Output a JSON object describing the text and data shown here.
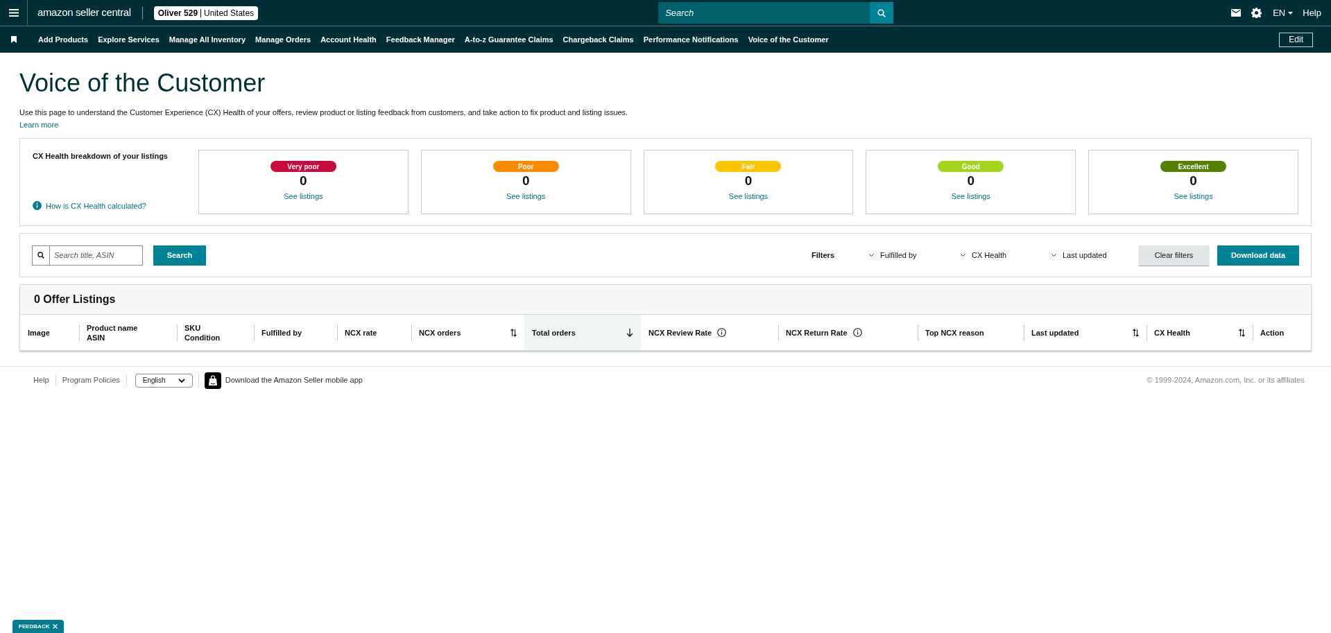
{
  "header": {
    "logo": "amazon seller central",
    "account": {
      "name": "Oliver 529",
      "market": "United States"
    },
    "search": {
      "placeholder": "Search"
    },
    "language": "EN",
    "help": "Help"
  },
  "nav": {
    "items": [
      "Add Products",
      "Explore Services",
      "Manage All Inventory",
      "Manage Orders",
      "Account Health",
      "Feedback Manager",
      "A-to-z Guarantee Claims",
      "Chargeback Claims",
      "Performance Notifications",
      "Voice of the Customer"
    ],
    "edit": "Edit"
  },
  "page": {
    "title": "Voice of the Customer",
    "description": "Use this page to understand the Customer Experience (CX) Health of your offers, review product or listing feedback from customers, and take action to fix product and listing issues.",
    "learn_more": "Learn more"
  },
  "breakdown": {
    "title": "CX Health breakdown of your listings",
    "help_link": "How is CX Health calculated?",
    "cards": [
      {
        "label": "Very poor",
        "color": "#c7093b",
        "count": "0",
        "link": "See listings"
      },
      {
        "label": "Poor",
        "color": "#ff8c00",
        "count": "0",
        "link": "See listings"
      },
      {
        "label": "Fair",
        "color": "#ffc400",
        "count": "0",
        "link": "See listings"
      },
      {
        "label": "Good",
        "color": "#a4d41c",
        "count": "0",
        "link": "See listings"
      },
      {
        "label": "Excellent",
        "color": "#538000",
        "count": "0",
        "link": "See listings"
      }
    ]
  },
  "filters": {
    "search": {
      "placeholder": "Search title, ASIN"
    },
    "search_button": "Search",
    "label": "Filters",
    "dropdowns": [
      "Fulfilled by",
      "CX Health",
      "Last updated"
    ],
    "clear": "Clear filters",
    "download": "Download data"
  },
  "table": {
    "title": "0 Offer Listings",
    "columns": [
      {
        "label": "Image",
        "kind": "plain",
        "selected": false
      },
      {
        "label": "Product name",
        "sublabel": "ASIN",
        "kind": "plain",
        "selected": false
      },
      {
        "label": "SKU",
        "sublabel": "Condition",
        "kind": "plain",
        "selected": false
      },
      {
        "label": "Fulfilled by",
        "kind": "plain",
        "selected": false
      },
      {
        "label": "NCX rate",
        "kind": "plain",
        "selected": false
      },
      {
        "label": "NCX orders",
        "kind": "sortable",
        "selected": false
      },
      {
        "label": "Total orders",
        "kind": "sortable",
        "selected": true
      },
      {
        "label": "NCX Review Rate",
        "kind": "info",
        "selected": false
      },
      {
        "label": "NCX Return Rate",
        "kind": "info",
        "selected": false
      },
      {
        "label": "Top NCX reason",
        "kind": "plain",
        "selected": false
      },
      {
        "label": "Last updated",
        "kind": "sortable",
        "selected": false
      },
      {
        "label": "CX Health",
        "kind": "sortable",
        "selected": false
      },
      {
        "label": "Action",
        "kind": "plain",
        "selected": false
      }
    ]
  },
  "footer": {
    "links": [
      "Help",
      "Program Policies"
    ],
    "language": "English",
    "app": "Download the Amazon Seller mobile app",
    "copyright": "© 1999-2024, Amazon.com, Inc. or its affiliates"
  },
  "feedback": "FEEDBACK"
}
